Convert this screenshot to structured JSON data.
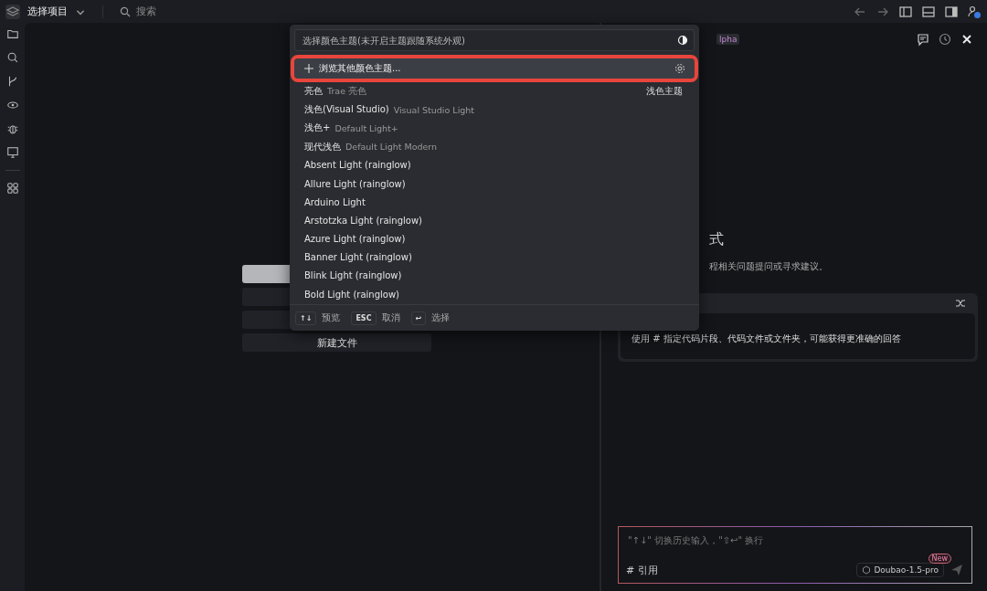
{
  "top_bar": {
    "project": "选择项目",
    "search_placeholder": "搜索"
  },
  "welcome_buttons": [
    {
      "kind": "primary"
    },
    {
      "kind": "plain"
    },
    {
      "kind": "plain"
    },
    {
      "kind": "plain",
      "label": "新建文件"
    }
  ],
  "chat_panel": {
    "badge": "lpha",
    "title": "式",
    "subtitle": "程相关问题提问或寻求建议。",
    "tip": "使用 # 指定代码片段、代码文件或文件夹，可能获得更准确的回答",
    "input_placeholder": "\"↑↓\" 切换历史输入，\"⇧↩\" 换行",
    "reference": "# 引用",
    "model": "Doubao-1.5-pro",
    "model_badge": "New"
  },
  "theme_picker": {
    "placeholder": "选择颜色主题(未开启主题跟随系统外观)",
    "browse": {
      "label": "浏览其他颜色主题...",
      "highlighted": true
    },
    "items": [
      {
        "label": "亮色",
        "detail": "Trae 亮色",
        "group": "浅色主题"
      },
      {
        "label": "浅色(Visual Studio)",
        "detail": "Visual Studio Light"
      },
      {
        "label": "浅色+",
        "detail": "Default Light+"
      },
      {
        "label": "现代浅色",
        "detail": "Default Light Modern"
      },
      {
        "label": "Absent Light (rainglow)"
      },
      {
        "label": "Allure Light (rainglow)"
      },
      {
        "label": "Arduino Light"
      },
      {
        "label": "Arstotzka Light (rainglow)"
      },
      {
        "label": "Azure Light (rainglow)"
      },
      {
        "label": "Banner Light (rainglow)"
      },
      {
        "label": "Blink Light (rainglow)"
      },
      {
        "label": "Bold Light (rainglow)"
      }
    ],
    "footer": [
      {
        "key": "↑↓",
        "label": "预览"
      },
      {
        "key": "ESC",
        "label": "取消"
      },
      {
        "key": "↩",
        "label": "选择"
      }
    ]
  }
}
